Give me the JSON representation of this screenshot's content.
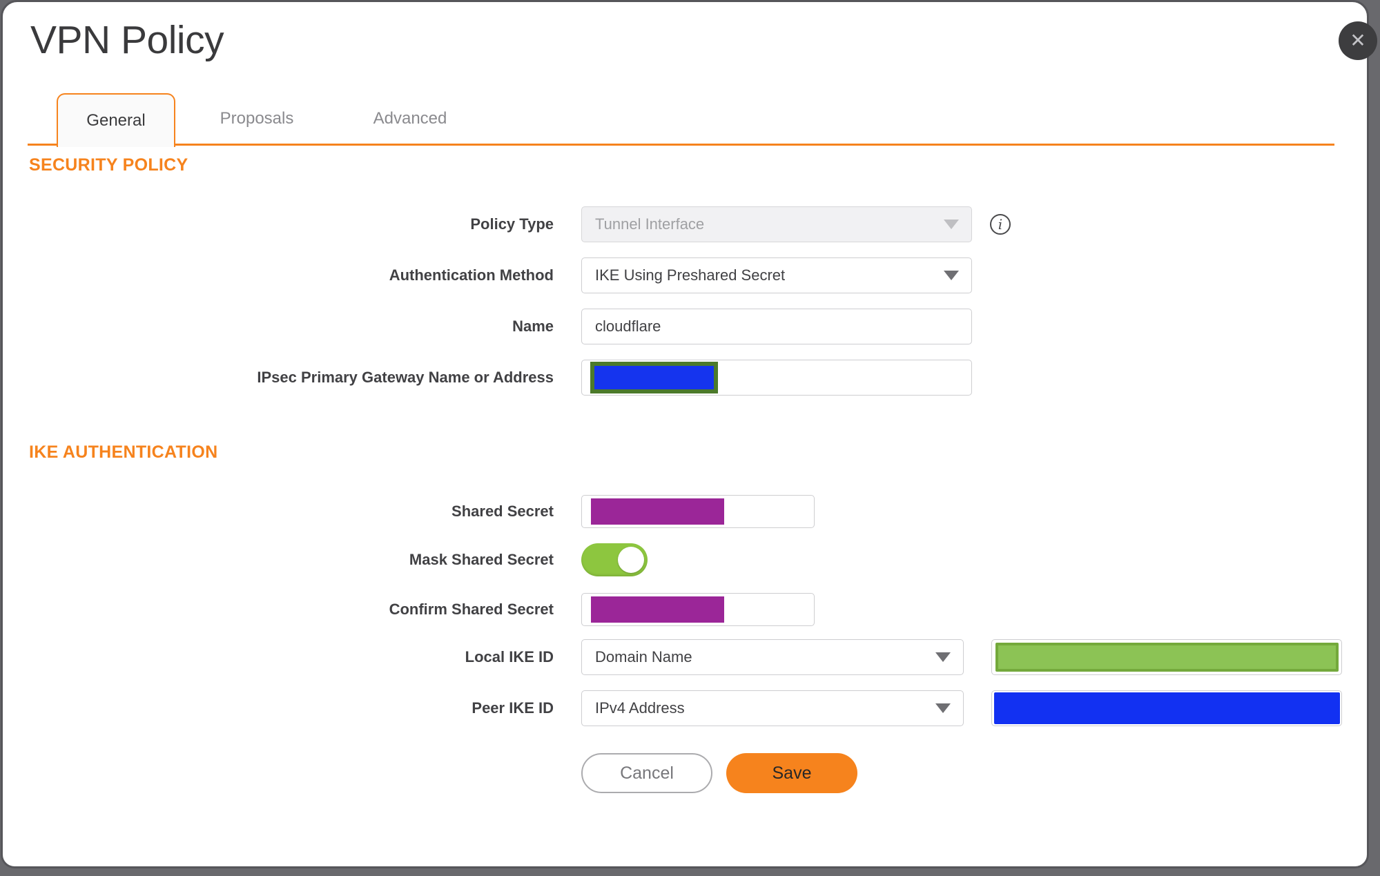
{
  "window": {
    "title": "VPN Policy"
  },
  "tabs": {
    "general": "General",
    "proposals": "Proposals",
    "advanced": "Advanced",
    "active_tab": "General"
  },
  "security_policy": {
    "heading": "SECURITY POLICY",
    "policy_type_label": "Policy Type",
    "policy_type_value": "Tunnel Interface",
    "policy_type_disabled": true,
    "auth_method_label": "Authentication Method",
    "auth_method_value": "IKE Using Preshared Secret",
    "name_label": "Name",
    "name_value": "cloudflare",
    "gateway_label": "IPsec Primary Gateway Name or Address"
  },
  "ike_authentication": {
    "heading": "IKE AUTHENTICATION",
    "shared_secret_label": "Shared Secret",
    "mask_shared_secret_label": "Mask Shared Secret",
    "mask_shared_secret_state": "on",
    "confirm_shared_secret_label": "Confirm Shared Secret",
    "local_ike_id_label": "Local IKE ID",
    "local_ike_id_type": "Domain Name",
    "peer_ike_id_label": "Peer IKE ID",
    "peer_ike_id_type": "IPv4 Address"
  },
  "redactions": {
    "gateway": {
      "fill": "#1534EE",
      "border": "#4C7A2B"
    },
    "shared_secret": {
      "fill": "#9B2698"
    },
    "confirm_shared_secret": {
      "fill": "#9B2698"
    },
    "local_ike_id": {
      "fill": "#8CC355",
      "border": "#74A93C"
    },
    "peer_ike_id": {
      "fill": "#1231F2"
    }
  },
  "icons": {
    "close": "✕",
    "info": "i"
  },
  "actions": {
    "cancel": "Cancel",
    "save": "Save"
  },
  "colors": {
    "accent_orange": "#F6831D",
    "toggle_green": "#8DC63F",
    "backdrop_gray": "#69696D",
    "dialog_border": "#56565A"
  }
}
